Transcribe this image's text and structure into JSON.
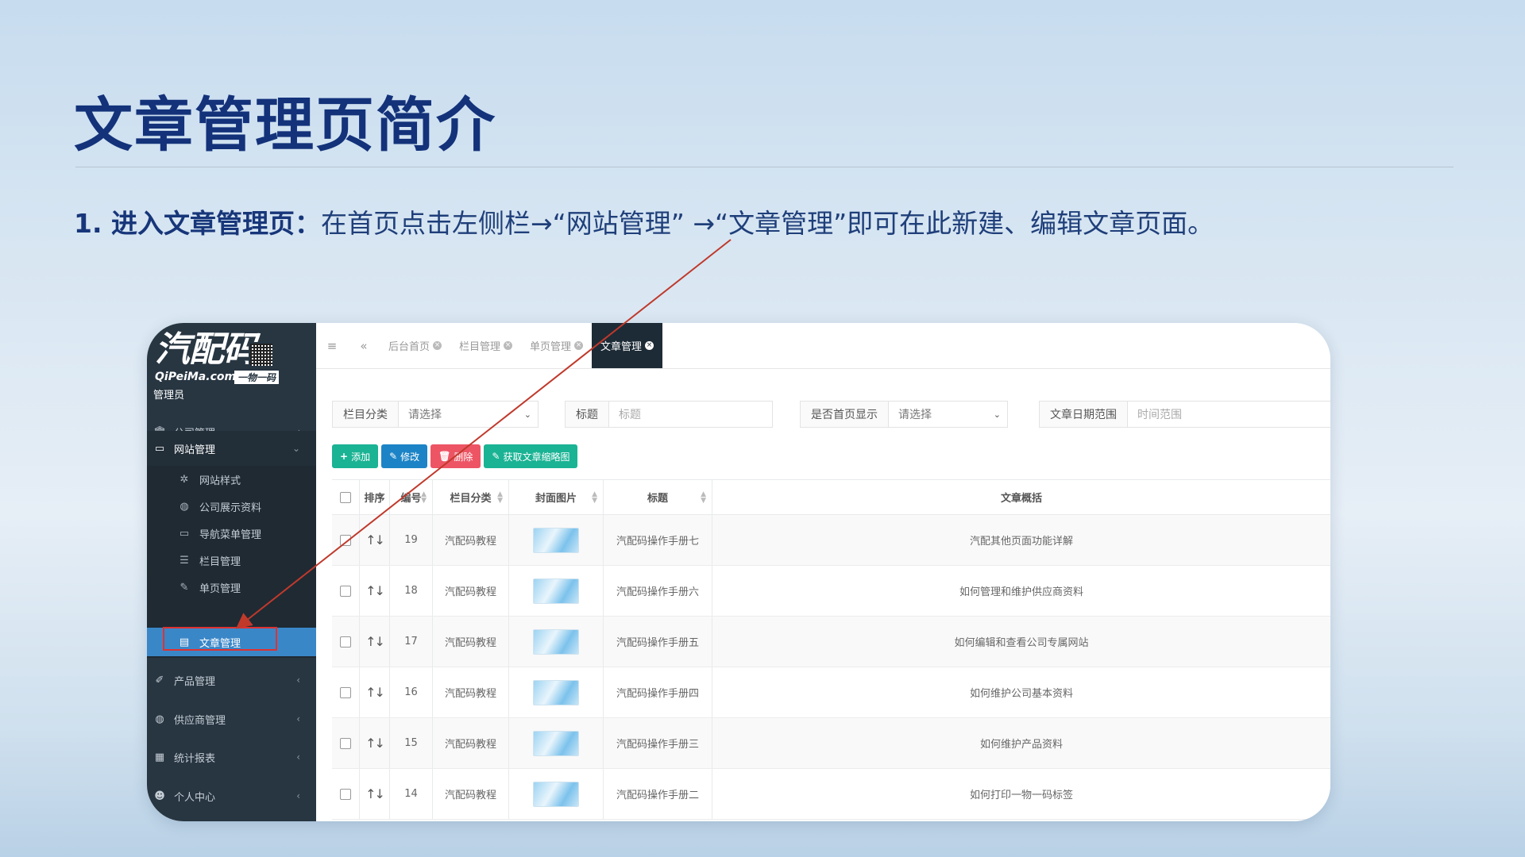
{
  "slide": {
    "title": "文章管理页简介",
    "intro_lead": "1. 进入文章管理页：",
    "intro_text": "在首页点击左侧栏→“网站管理” →“文章管理”即可在此新建、编辑文章页面。"
  },
  "app": {
    "logo_main": "汽配码",
    "logo_sub": "QiPeiMa.com",
    "logo_tag": "一物一码",
    "role": "管理员"
  },
  "sidebar": {
    "groups": [
      {
        "label": "公司管理",
        "icon": "bank-icon"
      },
      {
        "label": "网站管理",
        "icon": "monitor-icon"
      },
      {
        "label": "产品管理",
        "icon": "wrench-icon"
      },
      {
        "label": "供应商管理",
        "icon": "globe-icon"
      },
      {
        "label": "统计报表",
        "icon": "chart-icon"
      },
      {
        "label": "个人中心",
        "icon": "user-icon"
      }
    ],
    "sub_items": [
      {
        "label": "网站样式",
        "icon": "palette-icon"
      },
      {
        "label": "公司展示资料",
        "icon": "globe-icon"
      },
      {
        "label": "导航菜单管理",
        "icon": "desktop-icon"
      },
      {
        "label": "栏目管理",
        "icon": "list-icon"
      },
      {
        "label": "单页管理",
        "icon": "edit-icon"
      },
      {
        "label": "文章管理",
        "icon": "article-icon"
      }
    ]
  },
  "tabs": [
    {
      "label": "后台首页"
    },
    {
      "label": "栏目管理"
    },
    {
      "label": "单页管理"
    },
    {
      "label": "文章管理"
    }
  ],
  "filters": {
    "category_label": "栏目分类",
    "category_value": "请选择",
    "title_label": "标题",
    "title_placeholder": "标题",
    "home_label": "是否首页显示",
    "home_value": "请选择",
    "date_label": "文章日期范围",
    "date_placeholder": "时间范围"
  },
  "toolbar": {
    "add": "添加",
    "edit": "修改",
    "delete": "删除",
    "thumb": "获取文章缩略图"
  },
  "table": {
    "headers": {
      "sort": "排序",
      "no": "编号",
      "category": "栏目分类",
      "cover": "封面图片",
      "title": "标题",
      "summary": "文章概括"
    },
    "rows": [
      {
        "no": "19",
        "category": "汽配码教程",
        "title": "汽配码操作手册七",
        "summary": "汽配其他页面功能详解"
      },
      {
        "no": "18",
        "category": "汽配码教程",
        "title": "汽配码操作手册六",
        "summary": "如何管理和维护供应商资料"
      },
      {
        "no": "17",
        "category": "汽配码教程",
        "title": "汽配码操作手册五",
        "summary": "如何编辑和查看公司专属网站"
      },
      {
        "no": "16",
        "category": "汽配码教程",
        "title": "汽配码操作手册四",
        "summary": "如何维护公司基本资料"
      },
      {
        "no": "15",
        "category": "汽配码教程",
        "title": "汽配码操作手册三",
        "summary": "如何维护产品资料"
      },
      {
        "no": "14",
        "category": "汽配码教程",
        "title": "汽配码操作手册二",
        "summary": "如何打印一物一码标签"
      }
    ]
  },
  "colors": {
    "sidebar_bg": "#283642",
    "active_menu": "#3a87c8",
    "highlight": "#e03131",
    "title_color": "#13327a"
  }
}
